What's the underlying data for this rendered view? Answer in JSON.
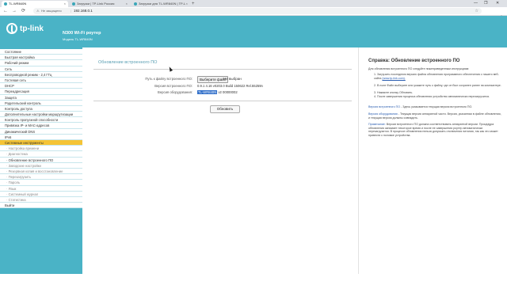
{
  "browser": {
    "tabs": [
      {
        "label": "TL-WR840N",
        "active": true
      },
      {
        "label": "Загрузки | TP-Link Россия",
        "active": false
      },
      {
        "label": "Загрузки для TL-WR840N | TP-L",
        "active": false
      }
    ],
    "new_tab": "+",
    "nav_back": "←",
    "nav_forward": "→",
    "nav_reload": "⟳",
    "security_label": "Не защищено",
    "url": "192.168.0.1",
    "minimize": "—",
    "maximize": "❐",
    "close": "✕"
  },
  "header": {
    "logo_text": "tp-link",
    "product_title": "N300 Wi-Fi роутер",
    "model": "Модель TL-WR840N",
    "color": "#4ab3c6"
  },
  "sidebar": {
    "items": [
      {
        "label": "Состояние",
        "type": "main"
      },
      {
        "label": "Быстрая настройка",
        "type": "main"
      },
      {
        "label": "Рабочий режим",
        "type": "main"
      },
      {
        "label": "Сеть",
        "type": "main"
      },
      {
        "label": "Беспроводной режим - 2,4 ГГц",
        "type": "main"
      },
      {
        "label": "Гостевая сеть",
        "type": "main"
      },
      {
        "label": "DHCP",
        "type": "main"
      },
      {
        "label": "Переадресация",
        "type": "main"
      },
      {
        "label": "Защита",
        "type": "main"
      },
      {
        "label": "Родительский контроль",
        "type": "main"
      },
      {
        "label": "Контроль доступа",
        "type": "main"
      },
      {
        "label": "Дополнительные настройки маршрутизации",
        "type": "main"
      },
      {
        "label": "Контроль пропускной способности",
        "type": "main"
      },
      {
        "label": "Привязка IP- и MAC-адресов",
        "type": "main"
      },
      {
        "label": "Динамический DNS",
        "type": "main"
      },
      {
        "label": "IPv6",
        "type": "main"
      },
      {
        "label": "Системные инструменты",
        "type": "active"
      },
      {
        "label": "Настройка времени",
        "type": "sub"
      },
      {
        "label": "Диагностика",
        "type": "sub"
      },
      {
        "label": "Обновление встроенного ПО",
        "type": "current"
      },
      {
        "label": "Заводские настройки",
        "type": "sub"
      },
      {
        "label": "Резервная копия и восстановление",
        "type": "sub"
      },
      {
        "label": "Перезагрузить",
        "type": "sub"
      },
      {
        "label": "Пароль",
        "type": "sub"
      },
      {
        "label": "Язык",
        "type": "sub"
      },
      {
        "label": "Системный журнал",
        "type": "sub"
      },
      {
        "label": "Статистика",
        "type": "sub"
      },
      {
        "label": "Выйти",
        "type": "main"
      }
    ],
    "active_color": "#f5c436"
  },
  "main": {
    "section_title": "Обновление встроенного ПО",
    "file_path_label": "Путь к файлу встроенного ПО:",
    "choose_file_button": "Выберите файл",
    "no_file_text": "Не выбран",
    "fw_version_label": "Версия встроенного ПО:",
    "fw_version_value": "0.9.1 4.16 v0203.0 Build 150622 Rel.55259n",
    "hw_version_label": "Версия оборудования:",
    "hw_version_highlight": "TL-WR840N",
    "hw_version_rest": "v2 00000002",
    "upgrade_button": "Обновить"
  },
  "help": {
    "title": "Справка: Обновление встроенного ПО",
    "intro": "Для обновления встроенного ПО следуйте нижеприведенным инструкциям:",
    "steps": [
      "1. Загрузить последнюю версию файла обновления программного обеспечения с нашего веб-сайта",
      "2. В поле Файл выберите или укажите путь к файлу, где он был сохранен ранее на компьютере.",
      "3. Нажмите кнопку Обновить.",
      "4. После завершения процесса обновления устройство автоматически перезагрузится."
    ],
    "site_link": "(www.tp-link.com).",
    "fw_note_label": "Версия встроенного ПО",
    "fw_note": " - Здесь указывается текущая версия встроенного ПО.",
    "hw_note_label": "Версия оборудования",
    "hw_note": " - Текущая версия аппаратной части. Версия, указанная в файле обновления, и текущая версия должны совпадать.",
    "warning_label": "Примечание:",
    "warning": " Версии встроенного ПО должна соответствовать аппаратной версии. Процедура обновления занимает некоторое время и после ее завершения роутер автоматически перезагрузится. В процессе обновления нельзя допускать отключения питания, так как это может привести к поломке устройства."
  }
}
